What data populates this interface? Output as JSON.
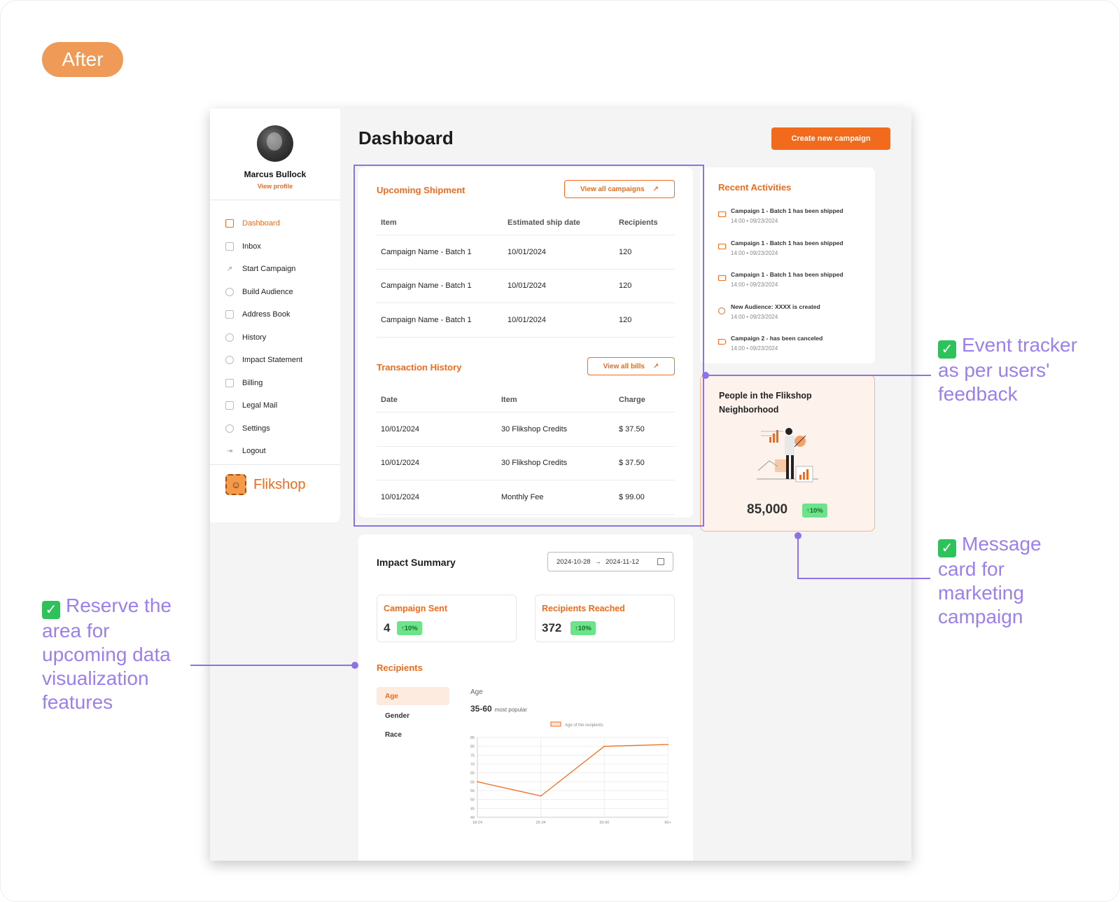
{
  "badge_after": "After",
  "sidebar": {
    "user_name": "Marcus Bullock",
    "view_profile": "View profile",
    "items": [
      {
        "label": "Dashboard",
        "icon": "dashboard-icon"
      },
      {
        "label": "Inbox",
        "icon": "inbox-icon"
      },
      {
        "label": "Start Campaign",
        "icon": "arrow-up-right-icon"
      },
      {
        "label": "Build Audience",
        "icon": "users-icon"
      },
      {
        "label": "Address Book",
        "icon": "book-icon"
      },
      {
        "label": "History",
        "icon": "history-icon"
      },
      {
        "label": "Impact Statement",
        "icon": "pie-icon"
      },
      {
        "label": "Billing",
        "icon": "receipt-icon"
      },
      {
        "label": "Legal Mail",
        "icon": "mail-icon"
      },
      {
        "label": "Settings",
        "icon": "gear-icon"
      },
      {
        "label": "Logout",
        "icon": "logout-icon"
      }
    ],
    "brand": "Flikshop"
  },
  "header": {
    "title": "Dashboard",
    "create_button": "Create new campaign"
  },
  "upcoming": {
    "title": "Upcoming Shipment",
    "button": "View all campaigns",
    "columns": [
      "Item",
      "Estimated ship date",
      "Recipients"
    ],
    "rows": [
      [
        "Campaign Name - Batch 1",
        "10/01/2024",
        "120"
      ],
      [
        "Campaign Name - Batch 1",
        "10/01/2024",
        "120"
      ],
      [
        "Campaign Name - Batch 1",
        "10/01/2024",
        "120"
      ]
    ]
  },
  "transactions": {
    "title": "Transaction History",
    "button": "View all bills",
    "columns": [
      "Date",
      "Item",
      "Charge"
    ],
    "rows": [
      [
        "10/01/2024",
        "30 Flikshop Credits",
        "$ 37.50"
      ],
      [
        "10/01/2024",
        "30 Flikshop Credits",
        "$ 37.50"
      ],
      [
        "10/01/2024",
        "Monthly Fee",
        "$ 99.00"
      ]
    ]
  },
  "recent": {
    "title": "Recent Activities",
    "items": [
      {
        "title": "Campaign 1 - Batch 1 has been shipped",
        "time": "14:00 • 09/23/2024",
        "icon": "mail-icon"
      },
      {
        "title": "Campaign 1 - Batch 1 has been shipped",
        "time": "14:00 • 09/23/2024",
        "icon": "mail-icon"
      },
      {
        "title": "Campaign 1 - Batch 1 has been shipped",
        "time": "14:00 • 09/23/2024",
        "icon": "mail-icon"
      },
      {
        "title": "New Audience: XXXX is created",
        "time": "14:00 • 09/23/2024",
        "icon": "users-icon"
      },
      {
        "title": "Campaign 2 - has been canceled",
        "time": "14:00 • 09/23/2024",
        "icon": "megaphone-icon"
      }
    ]
  },
  "neighborhood": {
    "title": "People in the Flikshop Neighborhood",
    "value": "85,000",
    "change": "↑10%"
  },
  "impact": {
    "title": "Impact Summary",
    "date_from": "2024-10-28",
    "date_sep": "→",
    "date_to": "2024-11-12",
    "stats": [
      {
        "label": "Campaign Sent",
        "value": "4",
        "change": "↑10%"
      },
      {
        "label": "Recipients Reached",
        "value": "372",
        "change": "↑10%"
      }
    ],
    "recipients_title": "Recipients",
    "tabs": [
      "Age",
      "Gender",
      "Race"
    ],
    "chart_label": "Age",
    "popular_value": "35-60",
    "popular_suffix": "most popular"
  },
  "chart_data": {
    "type": "line",
    "categories": [
      "18-24",
      "25-34",
      "35-60",
      "60+"
    ],
    "series": [
      {
        "name": "Age of the recipients",
        "values": [
          60,
          52,
          80,
          81
        ]
      }
    ],
    "yticks": [
      "85",
      "80",
      "75",
      "70",
      "65",
      "60",
      "55",
      "50",
      "45",
      "40"
    ],
    "ylim": [
      40,
      85
    ],
    "color": "#f26b1d"
  },
  "annotations": {
    "event": "Event tracker as per users' feedback",
    "message": "Message card for marketing campaign",
    "reserve": "Reserve the area for upcoming data visualization features"
  },
  "colors": {
    "accent": "#f26b1d",
    "annotation": "#8d72e6",
    "badge_green": "#6ee48a"
  }
}
